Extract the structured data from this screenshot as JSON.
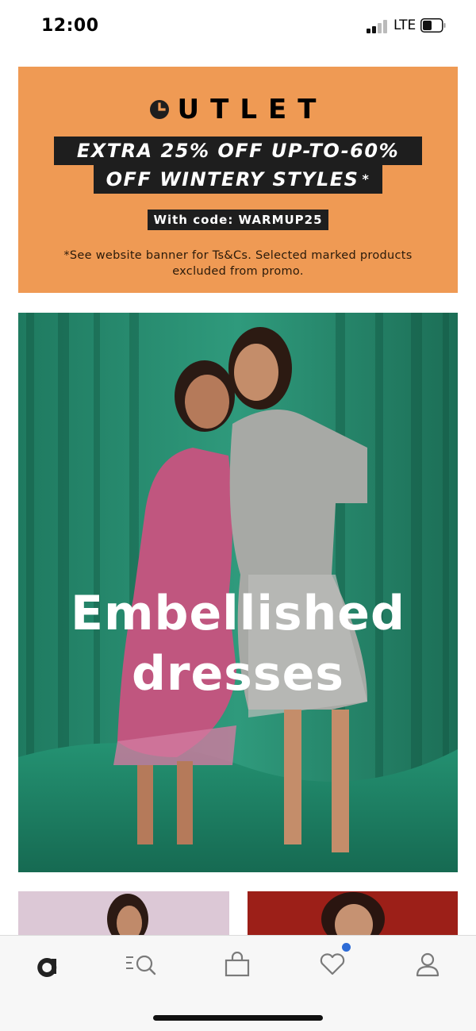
{
  "status_bar": {
    "time": "12:00",
    "network": "LTE",
    "icons": [
      "signal-icon",
      "battery-icon"
    ]
  },
  "promo": {
    "title": "UTLET",
    "line1": "EXTRA 25% OFF UP-TO-60%",
    "line2": "OFF WINTERY STYLES",
    "line2_mark": "*",
    "code": "With code: WARMUP25",
    "disclaimer": "*See website banner for Ts&Cs. Selected marked products excluded from promo.",
    "background": "#ef9a54",
    "icon": "clock-icon"
  },
  "hero": {
    "caption_line1": "Embellished",
    "caption_line2": "dresses",
    "background": "#2a8a6e"
  },
  "bottom_nav": {
    "items": [
      {
        "icon": "home-icon"
      },
      {
        "icon": "search-icon"
      },
      {
        "icon": "bag-icon"
      },
      {
        "icon": "heart-icon",
        "badge": true
      },
      {
        "icon": "account-icon"
      }
    ],
    "badge_color": "#2d6bd6"
  }
}
